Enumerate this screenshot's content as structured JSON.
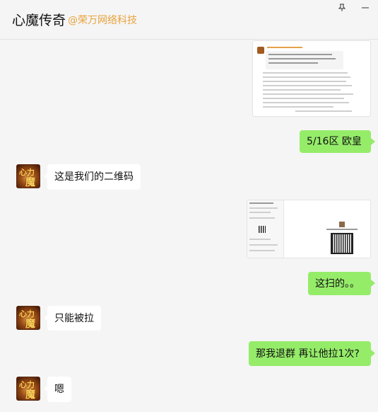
{
  "header": {
    "title": "心魔传奇",
    "org": "@荣万网络科技"
  },
  "messages": [
    {
      "side": "out",
      "type": "image",
      "desc": "screenshot-1"
    },
    {
      "side": "out",
      "type": "text",
      "text": "5/16区  欧皇"
    },
    {
      "side": "in",
      "type": "text",
      "text": "这是我们的二维码"
    },
    {
      "side": "out",
      "type": "image",
      "desc": "screenshot-2"
    },
    {
      "side": "out",
      "type": "text",
      "text": "这扫的。。"
    },
    {
      "side": "in",
      "type": "text",
      "text": "只能被拉"
    },
    {
      "side": "out",
      "type": "text",
      "text": "那我退群 再让他拉1次?"
    },
    {
      "side": "in",
      "type": "text",
      "text": "嗯"
    }
  ],
  "avatar": {
    "glyph_top": "心力",
    "glyph_bottom": "魔"
  },
  "icons": {
    "pin": "pin-icon",
    "minimize": "minimize-icon"
  },
  "colors": {
    "outgoing": "#95ec69",
    "incoming": "#ffffff",
    "org": "#e8a33d",
    "background": "#f5f5f5"
  }
}
